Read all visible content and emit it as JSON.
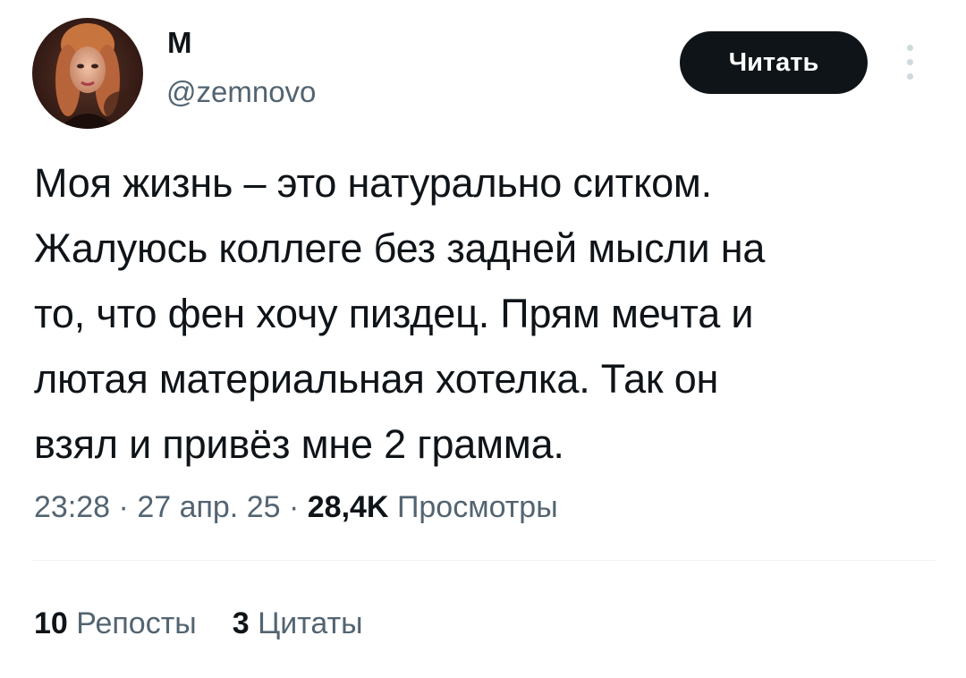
{
  "author": {
    "name": "М",
    "handle": "@zemnovo"
  },
  "follow_button": {
    "label": "Читать"
  },
  "more_button": {
    "icon": "more-vertical-icon"
  },
  "tweet": {
    "text": "Моя жизнь – это натурально ситком.\nЖалуюсь коллеге без задней мысли на\nто, что фен хочу пиздец. Прям мечта и\nлютая материальная хотелка. Так он\nвзял и привёз мне 2 грамма.",
    "time": "23:28",
    "date": "27 апр. 25",
    "separator": " · ",
    "views_count": "28,4K",
    "views_label": "Просмотры"
  },
  "stats": {
    "reposts_count": "10",
    "reposts_label": "Репосты",
    "quotes_count": "3",
    "quotes_label": "Цитаты"
  },
  "colors": {
    "text_primary": "#0f1419",
    "text_secondary": "#536471",
    "button_bg": "#0f1419",
    "divider": "#eff3f4"
  }
}
